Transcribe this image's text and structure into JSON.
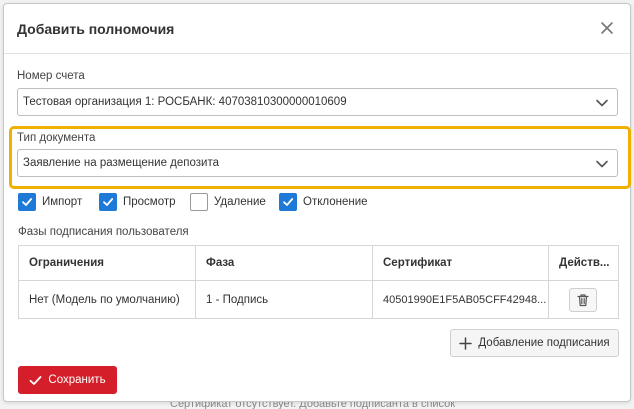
{
  "backdrop": {
    "text": "Сертификат отсутствует. Добавьте подписанта в список"
  },
  "modal": {
    "title": "Добавить полномочия"
  },
  "account": {
    "label": "Номер счета",
    "value": "Тестовая организация 1: РОСБАНК: 40703810300000010609"
  },
  "document_type": {
    "label": "Тип документа",
    "value": "Заявление на размещение депозита"
  },
  "permissions": [
    {
      "label": "Импорт",
      "checked": true
    },
    {
      "label": "Просмотр",
      "checked": true
    },
    {
      "label": "Удаление",
      "checked": false
    },
    {
      "label": "Отклонение",
      "checked": true
    }
  ],
  "phases": {
    "label": "Фазы подписания пользователя",
    "columns": [
      "Ограничения",
      "Фаза",
      "Сертификат",
      "Действ..."
    ],
    "rows": [
      {
        "restriction": "Нет (Модель по умолчанию)",
        "phase": "1 - Подпись",
        "certificate": "40501990E1F5AB05CFF42948..."
      }
    ]
  },
  "actions": {
    "add_signing": "Добавление подписания",
    "save": "Сохранить"
  },
  "colors": {
    "accent_blue": "#1e7ad6",
    "save_red": "#d41f2a",
    "highlight": "#f0b000"
  },
  "icons": {
    "close": "close-icon",
    "chevron": "chevron-down-icon",
    "check": "check-icon",
    "trash": "trash-icon",
    "plus": "plus-icon"
  }
}
